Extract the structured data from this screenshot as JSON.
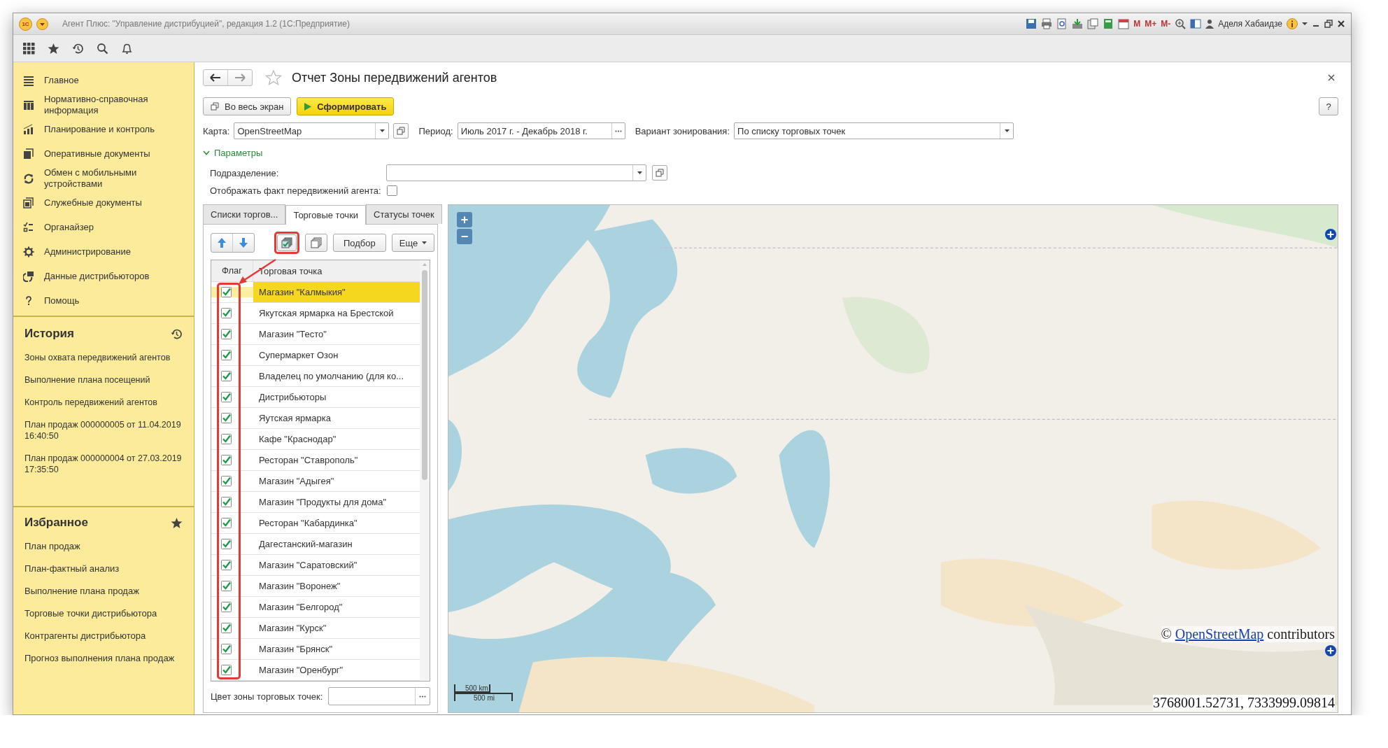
{
  "window": {
    "logo": "1С",
    "title": "Агент Плюс: \"Управление дистрибуцией\", редакция 1.2  (1С:Предприятие)",
    "memory_buttons": [
      "M",
      "M+",
      "M-"
    ],
    "user": "Аделя Хабаидзе"
  },
  "sidebar": {
    "sections": [
      "Главное",
      "Нормативно-справочная информация",
      "Планирование и контроль",
      "Оперативные документы",
      "Обмен с мобильными устройствами",
      "Служебные документы",
      "Органайзер",
      "Администрирование",
      "Данные дистрибьюторов",
      "Помощь"
    ],
    "history": {
      "title": "История",
      "items": [
        "Зоны охвата передвижений агентов",
        "Выполнение плана посещений",
        "Контроль передвижений агентов",
        "План продаж 000000005 от 11.04.2019 16:40:50",
        "План продаж 000000004 от 27.03.2019 17:35:50"
      ]
    },
    "favorites": {
      "title": "Избранное",
      "items": [
        "План продаж",
        "План-фактный анализ",
        "Выполнение плана продаж",
        "Торговые точки дистрибьютора",
        "Контрагенты дистрибьютора",
        "Прогноз выполнения плана продаж"
      ]
    }
  },
  "form": {
    "title": "Отчет Зоны передвижений агентов",
    "help": "?",
    "buttons": [
      {
        "label": "Во весь экран",
        "kind": "plain"
      },
      {
        "label": "Сформировать",
        "kind": "primary"
      }
    ],
    "fields": [
      {
        "label": "Карта:",
        "value": "OpenStreetMap",
        "kind": "dropdown"
      },
      {
        "label": "Период:",
        "value": "Июль 2017 г. - Декабрь 2018 г.",
        "kind": "choice"
      },
      {
        "label": "Вариант зонирования:",
        "value": "По списку торговых точек",
        "kind": "select"
      }
    ],
    "parameters": {
      "title": "Параметры",
      "expanded": true,
      "division_label": "Подразделение:",
      "show_movement": {
        "label": "Отображать факт передвижений агента:",
        "checked": false
      }
    }
  },
  "tabs": [
    {
      "label": "Списки торгов...",
      "selected": false
    },
    {
      "label": "Торговые точки",
      "selected": true
    },
    {
      "label": "Статусы точек",
      "selected": false
    }
  ],
  "table_toolbar": {
    "pick": "Подбор",
    "more": "Еще"
  },
  "table": {
    "columns": [
      "Флаг",
      "Торговая точка"
    ],
    "rows": [
      {
        "name": "Магазин \"Калмыкия\"",
        "checked": true,
        "selected": true
      },
      {
        "name": "Якутская ярмарка на Брестской",
        "checked": true,
        "selected": false
      },
      {
        "name": "Магазин \"Тесто\"",
        "checked": true,
        "selected": false
      },
      {
        "name": "Супермаркет Озон",
        "checked": true,
        "selected": false
      },
      {
        "name": "Владелец по умолчанию (для ко...",
        "checked": true,
        "selected": false
      },
      {
        "name": "Дистрибьюторы",
        "checked": true,
        "selected": false
      },
      {
        "name": "Яутская ярмарка",
        "checked": true,
        "selected": false
      },
      {
        "name": "Кафе \"Краснодар\"",
        "checked": true,
        "selected": false
      },
      {
        "name": "Ресторан \"Ставрополь\"",
        "checked": true,
        "selected": false
      },
      {
        "name": "Магазин \"Адыгея\"",
        "checked": true,
        "selected": false
      },
      {
        "name": "Магазин \"Продукты для дома\"",
        "checked": true,
        "selected": false
      },
      {
        "name": "Ресторан \"Кабардинка\"",
        "checked": true,
        "selected": false
      },
      {
        "name": "Дагестанский-магазин",
        "checked": true,
        "selected": false
      },
      {
        "name": "Магазин \"Саратовский\"",
        "checked": true,
        "selected": false
      },
      {
        "name": "Магазин \"Воронеж\"",
        "checked": true,
        "selected": false
      },
      {
        "name": "Магазин \"Белгород\"",
        "checked": true,
        "selected": false
      },
      {
        "name": "Магазин \"Курск\"",
        "checked": true,
        "selected": false
      },
      {
        "name": "Магазин \"Брянск\"",
        "checked": true,
        "selected": false
      },
      {
        "name": "Магазин \"Оренбург\"",
        "checked": true,
        "selected": false
      }
    ],
    "zone_color_label": "Цвет зоны торговых точек:"
  },
  "map": {
    "kind": "picture",
    "zoom": [
      "+",
      "−"
    ],
    "scale": [
      "500 km",
      "500 mi"
    ],
    "attribution": {
      "prefix": "©",
      "link": "OpenStreetMap",
      "suffix": "contributors"
    },
    "coordinates": "3768001.52731, 7333999.09814"
  }
}
